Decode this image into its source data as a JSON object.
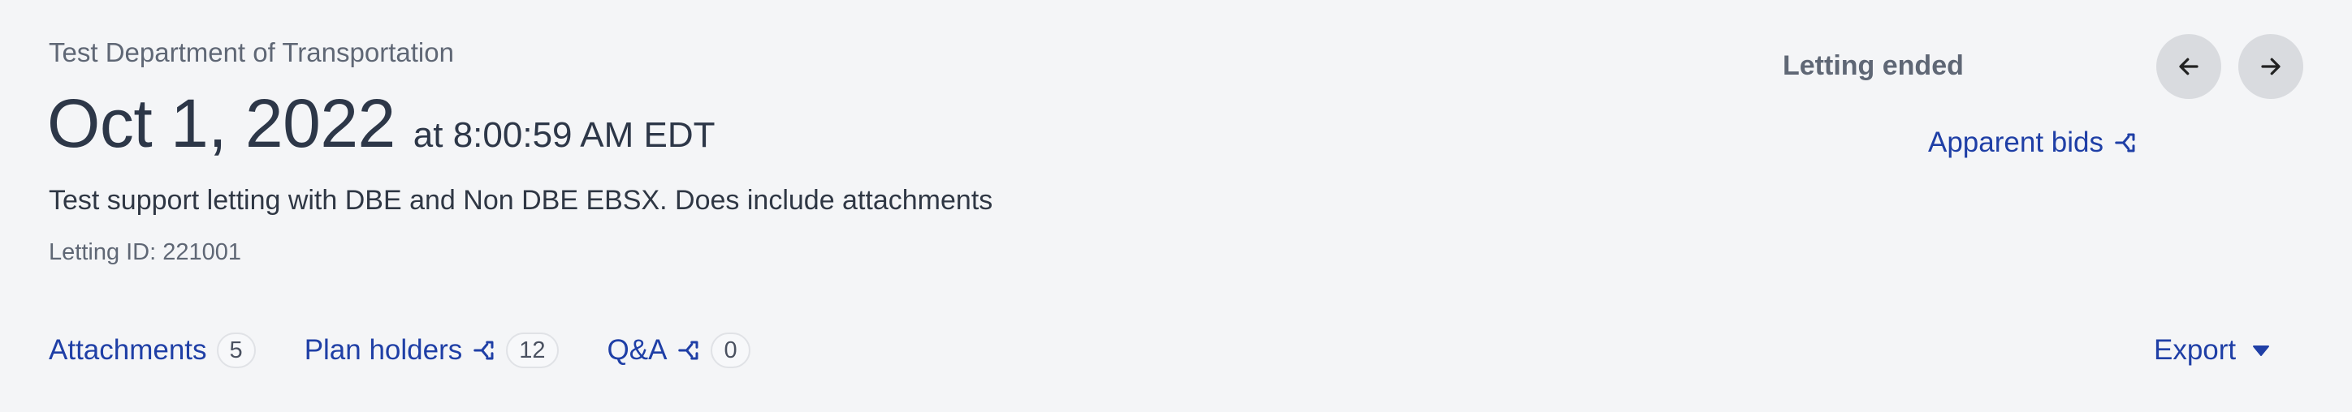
{
  "header": {
    "department": "Test Department of Transportation",
    "date": "Oct 1, 2022",
    "time": "at 8:00:59 AM EDT",
    "description": "Test support letting with DBE and Non DBE EBSX. Does include attachments",
    "letting_id": "Letting ID: 221001"
  },
  "status": {
    "label": "Letting ended"
  },
  "navigation": {
    "prev_icon": "arrow-left-icon",
    "next_icon": "arrow-right-icon"
  },
  "links": {
    "apparent_bids": "Apparent bids",
    "share_icon": "share-icon"
  },
  "tabs": [
    {
      "label": "Attachments",
      "count": "5",
      "has_share_icon": false
    },
    {
      "label": "Plan holders",
      "count": "12",
      "has_share_icon": true
    },
    {
      "label": "Q&A",
      "count": "0",
      "has_share_icon": true
    }
  ],
  "export": {
    "label": "Export",
    "icon": "caret-down-icon"
  },
  "colors": {
    "background": "#f4f5f7",
    "link": "#1f3fa6",
    "text_primary": "#2d3748",
    "text_muted": "#5f6775",
    "button_bg": "#d9dbdf"
  }
}
